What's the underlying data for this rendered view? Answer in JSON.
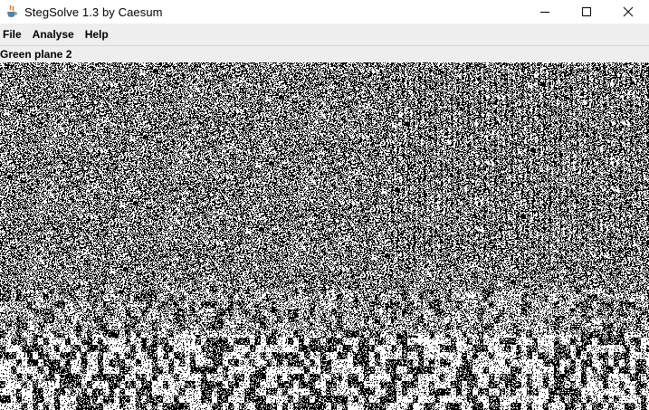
{
  "window": {
    "title": "StegSolve 1.3 by Caesum",
    "icon": "java-coffee-icon",
    "controls": [
      "minimize-icon",
      "maximize-icon",
      "close-icon"
    ]
  },
  "menu": {
    "items": [
      {
        "label": "File"
      },
      {
        "label": "Analyse"
      },
      {
        "label": "Help"
      }
    ]
  },
  "viewer": {
    "plane_label": "Green plane 2"
  }
}
